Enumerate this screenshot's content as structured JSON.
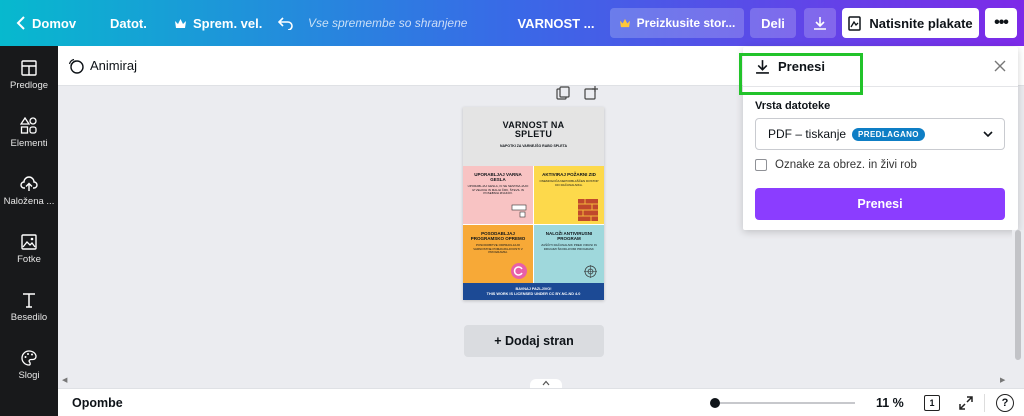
{
  "topbar": {
    "home_label": "Domov",
    "file_label": "Datot.",
    "resize_label": "Sprem. vel.",
    "saved_status": "Vse spremembe so shranjene",
    "document_title": "VARNOST ...",
    "try_label": "Preizkusite stor...",
    "share_label": "Deli",
    "print_label": "Natisnite plakate",
    "more_label": "•••"
  },
  "sidebar": {
    "items": [
      {
        "label": "Predloge",
        "icon": "layout-icon"
      },
      {
        "label": "Elementi",
        "icon": "shapes-icon"
      },
      {
        "label": "Naložena ...",
        "icon": "cloud-upload-icon"
      },
      {
        "label": "Fotke",
        "icon": "image-icon"
      },
      {
        "label": "Besedilo",
        "icon": "text-icon"
      },
      {
        "label": "Slogi",
        "icon": "palette-icon"
      }
    ]
  },
  "subbar": {
    "animate_label": "Animiraj"
  },
  "poster": {
    "title": "VARNOST NA SPLETU",
    "subtitle": "NAPOTKI ZA VARNEJŠO RABO SPLETA",
    "cells": [
      {
        "heading": "UPORABLJAJ VARNA GESLA",
        "text": "UPORABLJAJ GESLA, KI SE SESTAVLJAJO IZ VELIKIH IN MALIH ČRK, ŠTEVIL IN POSEBNIH ZNAKOV."
      },
      {
        "heading": "AKTIVIRAJ POŽARNI ZID",
        "text": "ONEMOGOČA NEPOOBLAŠČEN DOSTOP DO RAČUNALNIKA."
      },
      {
        "heading": "POSODABLJAJ PROGRAMSKO OPREMO",
        "text": "POSODOBITVE ODPRAVLJAJO VARNOSTNE POMANJKLJIVOSTI V PROGRAMIH."
      },
      {
        "heading": "NALOŽI ANTIVIRUSNI PROGRAM",
        "text": "ZAŠČITI RAČUNALNIK PRED VIRUSI IN DRUGIMI ŠKODLJIVIMI PROGRAMI."
      }
    ],
    "footer_line1": "BAVNAJ PAZLJIVO!",
    "footer_line2": "THIS WORK IS LICENSED UNDER CC BY-NC-ND 4.0"
  },
  "canvas": {
    "add_page_label": "+ Dodaj stran"
  },
  "download_panel": {
    "title": "Prenesi",
    "file_type_label": "Vrsta datoteke",
    "file_type_value": "PDF – tiskanje",
    "recommended_badge": "PREDLAGANO",
    "crop_marks_label": "Oznake za obrez. in živi rob",
    "download_button": "Prenesi",
    "highlight_color": "#22c32a"
  },
  "footer": {
    "notes_label": "Opombe",
    "zoom_value": "11 %",
    "page_number": "1",
    "help_label": "?"
  },
  "colors": {
    "primary_purple": "#8b3dff",
    "badge_blue": "#0e7ec5",
    "sidebar_bg": "#18191b"
  }
}
